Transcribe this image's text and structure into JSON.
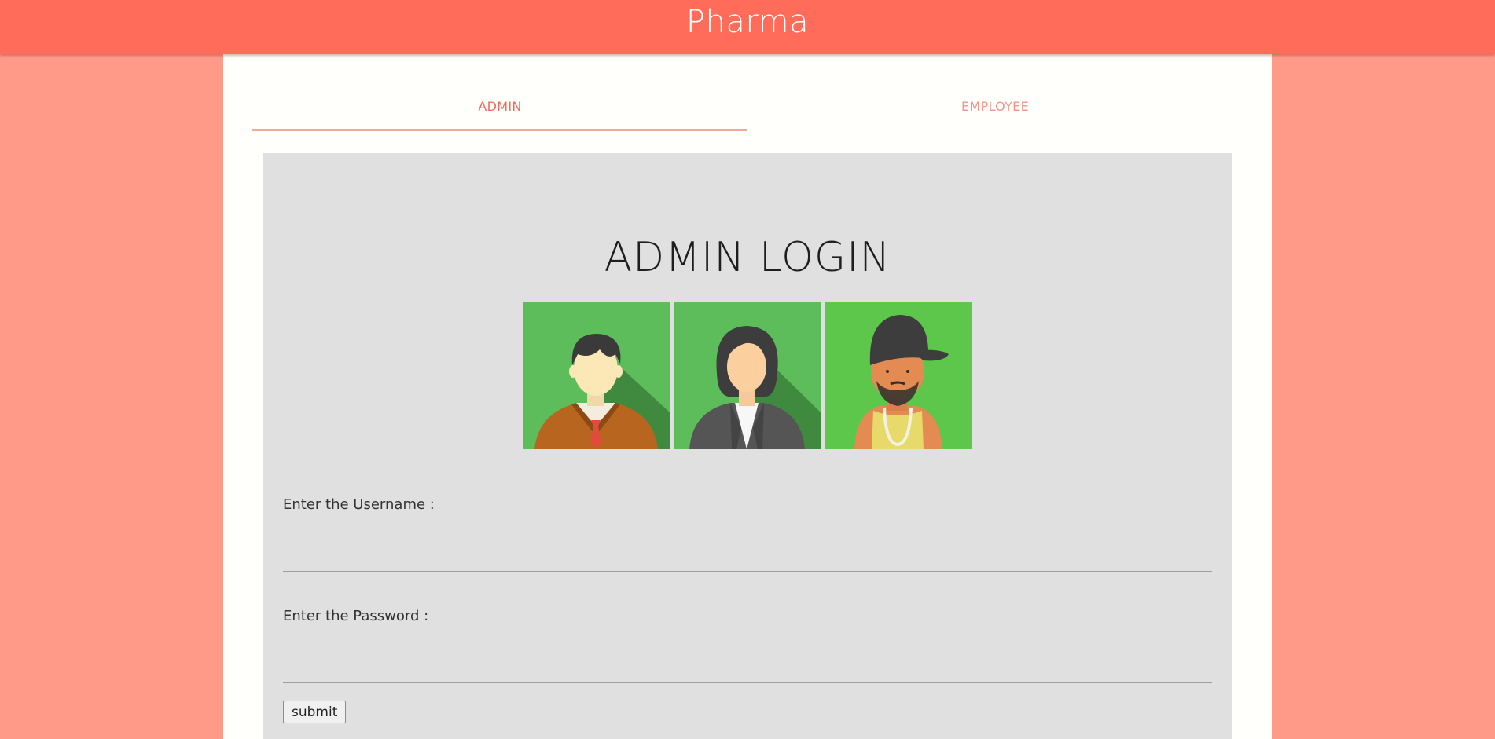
{
  "header": {
    "brand": "Pharma"
  },
  "tabs": [
    {
      "label": "ADMIN",
      "active": true
    },
    {
      "label": "EMPLOYEE",
      "active": false
    }
  ],
  "login": {
    "title": "ADMIN LOGIN",
    "avatars": [
      {
        "icon": "man-with-tie-avatar-icon"
      },
      {
        "icon": "woman-in-suit-avatar-icon"
      },
      {
        "icon": "man-with-cap-avatar-icon"
      }
    ],
    "username_label": "Enter the Username :",
    "username_value": "",
    "password_label": "Enter the Password :",
    "password_value": "",
    "submit_label": "submit"
  },
  "colors": {
    "topbar": "#ff6c5a",
    "background": "#ff9988",
    "card": "#fffffc",
    "panel": "#e0e0e0",
    "accent": "#f06b5c"
  }
}
